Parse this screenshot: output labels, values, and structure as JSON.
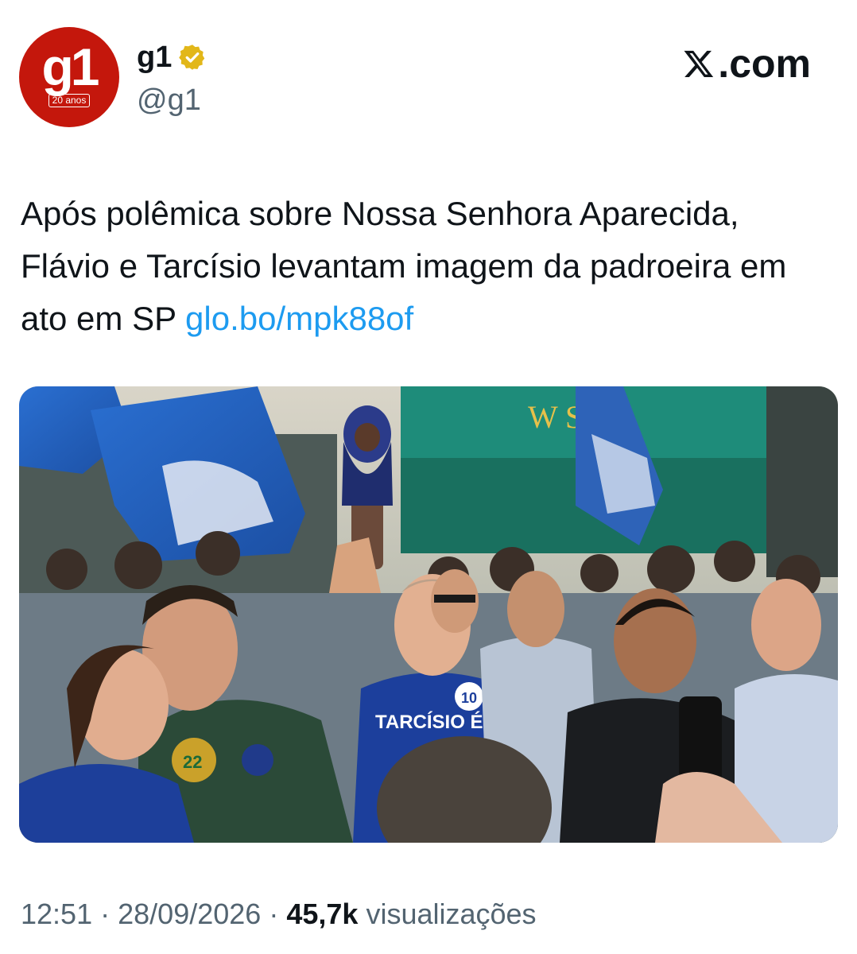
{
  "account": {
    "avatar_mark": "g1",
    "avatar_subtext": "20 anos",
    "display_name": "g1",
    "handle": "@g1",
    "verified_icon": "verified-gold-badge-icon",
    "avatar_color": "#c4170c"
  },
  "brand": {
    "label": ".com",
    "icon": "x-logo-icon"
  },
  "tweet": {
    "text": "Após polêmica sobre Nossa Senhora Aparecida, Flávio e Tarcísio levantam imagem da padroeira em ato em SP",
    "link": "glo.bo/mpk88of",
    "link_color": "#1d9bf0",
    "media": {
      "sign_text": "W SH",
      "shirt_text": "TARCÍSIO É",
      "badge_number": "10",
      "campaign_button_number": "22"
    }
  },
  "meta": {
    "time": "12:51",
    "separator": "·",
    "date": "28/09/2026",
    "views_count": "45,7k",
    "views_label": "visualizações"
  }
}
